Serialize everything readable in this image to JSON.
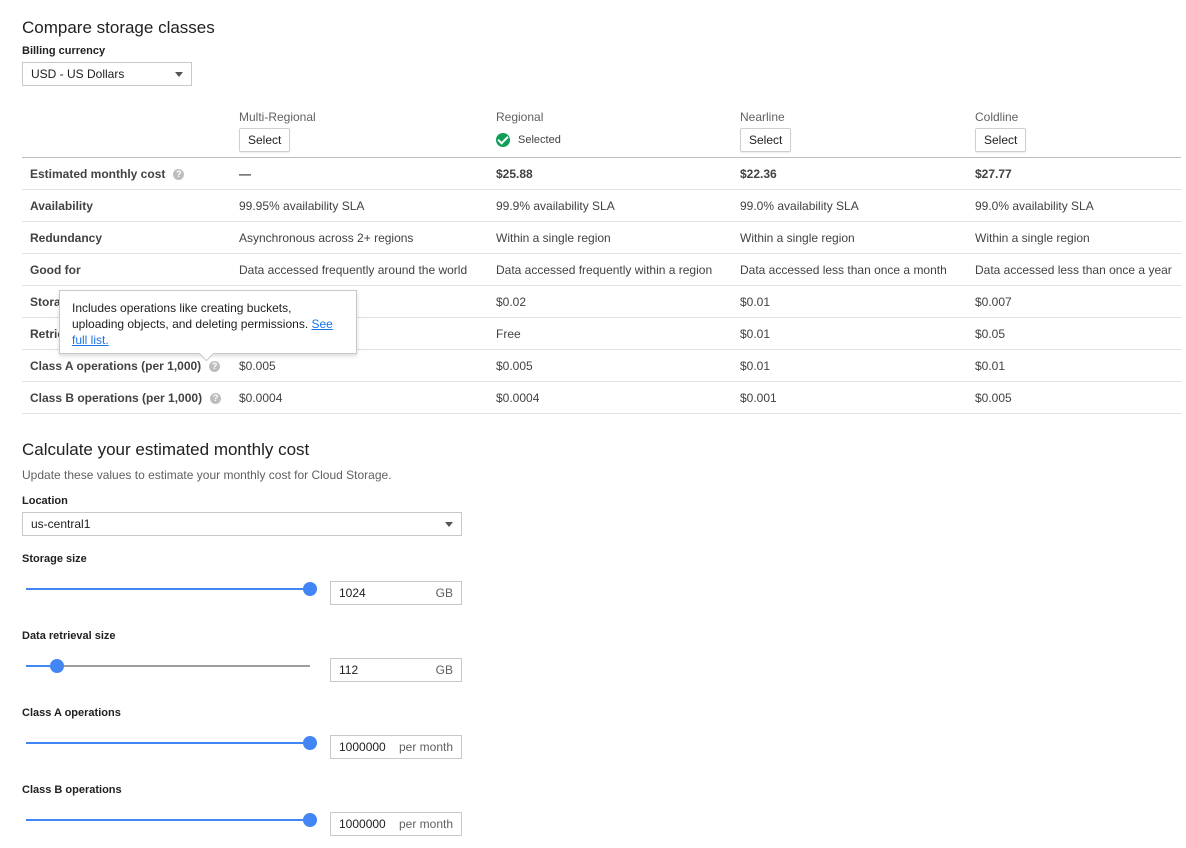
{
  "compare": {
    "title": "Compare storage classes",
    "billing_label": "Billing currency",
    "billing_value": "USD - US Dollars",
    "columns": [
      {
        "name": "Multi-Regional",
        "action": "Select"
      },
      {
        "name": "Regional",
        "action": "Selected"
      },
      {
        "name": "Nearline",
        "action": "Select"
      },
      {
        "name": "Coldline",
        "action": "Select"
      }
    ],
    "rows": [
      {
        "label": "Estimated monthly cost",
        "help": "?",
        "values": [
          "—",
          "$25.88",
          "$22.36",
          "$27.77"
        ]
      },
      {
        "label": "Availability",
        "values": [
          "99.95% availability SLA",
          "99.9% availability SLA",
          "99.0% availability SLA",
          "99.0% availability SLA"
        ]
      },
      {
        "label": "Redundancy",
        "values": [
          "Asynchronous across 2+ regions",
          "Within a single region",
          "Within a single region",
          "Within a single region"
        ]
      },
      {
        "label": "Good for",
        "values": [
          "Data accessed frequently around the world",
          "Data accessed frequently within a region",
          "Data accessed less than once a month",
          "Data accessed less than once a year"
        ]
      },
      {
        "label": "Stora",
        "values": [
          "",
          "$0.02",
          "$0.01",
          "$0.007"
        ]
      },
      {
        "label": "Retrie",
        "values": [
          "",
          "Free",
          "$0.01",
          "$0.05"
        ]
      },
      {
        "label": "Class A operations (per 1,000)",
        "help": "?",
        "values": [
          "$0.005",
          "$0.005",
          "$0.01",
          "$0.01"
        ]
      },
      {
        "label": "Class B operations (per 1,000)",
        "help": "?",
        "values": [
          "$0.0004",
          "$0.0004",
          "$0.001",
          "$0.005"
        ]
      }
    ],
    "tooltip": {
      "text": "Includes operations like creating buckets, uploading objects, and deleting permissions.",
      "link": "See full list."
    }
  },
  "calc": {
    "title": "Calculate your estimated monthly cost",
    "subtitle": "Update these values to estimate your monthly cost for Cloud Storage.",
    "location_label": "Location",
    "location_value": "us-central1",
    "sliders": [
      {
        "label": "Storage size",
        "value": "1024",
        "unit": "GB",
        "fraction": 1.0
      },
      {
        "label": "Data retrieval size",
        "value": "112",
        "unit": "GB",
        "fraction": 0.11
      },
      {
        "label": "Class A operations",
        "value": "1000000",
        "unit": "per month",
        "fraction": 1.0
      },
      {
        "label": "Class B operations",
        "value": "1000000",
        "unit": "per month",
        "fraction": 1.0
      }
    ]
  },
  "colors": {
    "accent": "#4285f4",
    "selected": "#0f9d58",
    "link": "#1a73e8"
  }
}
